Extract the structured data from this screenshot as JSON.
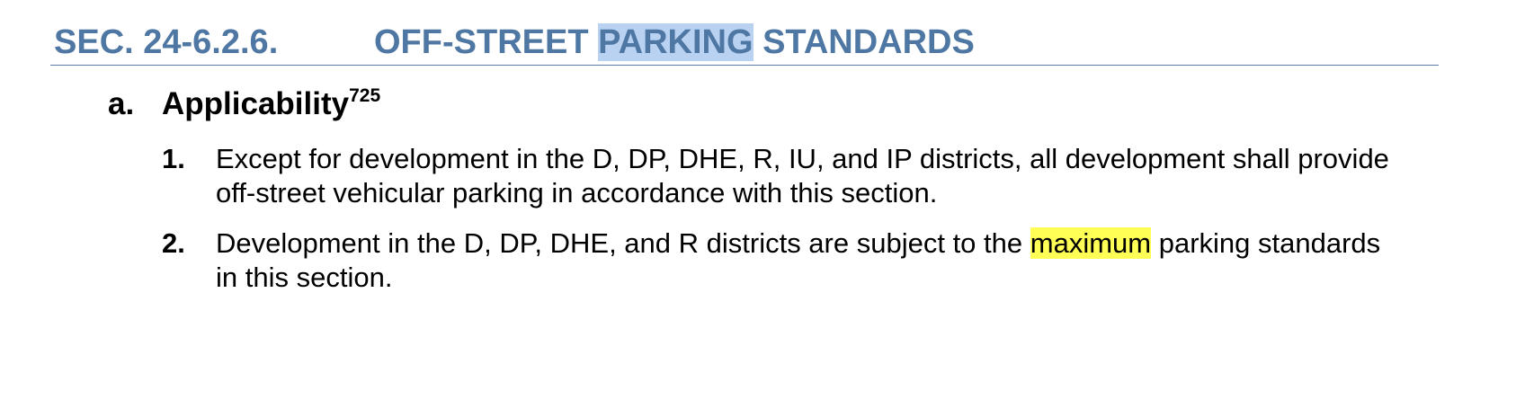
{
  "section": {
    "number": "SEC. 24-6.2.6.",
    "title_prefix": "OFF-STREET ",
    "title_selected": "PARKING",
    "title_suffix": " STANDARDS"
  },
  "subsection": {
    "marker": "a.",
    "title": "Applicability",
    "footnote": "725"
  },
  "items": [
    {
      "number": "1.",
      "text": "Except for development in the D, DP, DHE, R, IU, and IP districts, all development shall provide off-street vehicular parking in accordance with this section."
    },
    {
      "number": "2.",
      "text_before": "Development in the D, DP, DHE, and R districts are subject to the ",
      "highlighted": "maximum",
      "text_after": " parking standards in this section."
    }
  ],
  "colors": {
    "heading": "#4f77a3",
    "selection": "#b9d2f2",
    "highlight": "#ffff55"
  }
}
